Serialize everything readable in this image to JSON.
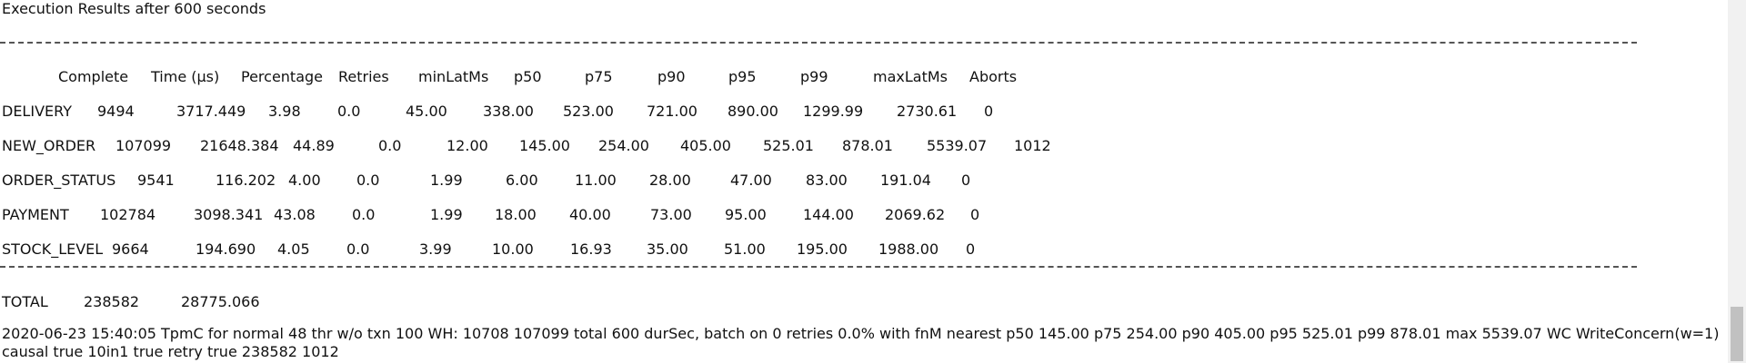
{
  "title": "Execution Results after 600 seconds",
  "divider": "------------------------------------------------------------------------------------------------------------------------------------------------------------------------------------------------------------------------------------------------------------------------------------------------------------",
  "headers": [
    "Complete",
    "Time (µs)",
    "Percentage",
    "Retries",
    "minLatMs",
    "p50",
    "p75",
    "p90",
    "p95",
    "p99",
    "maxLatMs",
    "Aborts"
  ],
  "rows": [
    {
      "cells": [
        "DELIVERY",
        "9494",
        "3717.449",
        "3.98",
        "0.0",
        "45.00",
        "338.00",
        "523.00",
        "721.00",
        "890.00",
        "1299.99",
        "2730.61",
        "0"
      ]
    },
    {
      "cells": [
        "NEW_ORDER",
        "107099",
        "21648.384",
        "44.89",
        "0.0",
        "12.00",
        "145.00",
        "254.00",
        "405.00",
        "525.01",
        "878.01",
        "5539.07",
        "1012"
      ]
    },
    {
      "cells": [
        "ORDER_STATUS",
        "9541",
        "116.202",
        "4.00",
        "0.0",
        "1.99",
        "6.00",
        "11.00",
        "28.00",
        "47.00",
        "83.00",
        "191.04",
        "0"
      ]
    },
    {
      "cells": [
        "PAYMENT",
        "102784",
        "3098.341",
        "43.08",
        "0.0",
        "1.99",
        "18.00",
        "40.00",
        "73.00",
        "95.00",
        "144.00",
        "2069.62",
        "0"
      ]
    },
    {
      "cells": [
        "STOCK_LEVEL",
        "9664",
        "194.690",
        "4.05",
        "0.0",
        "3.99",
        "10.00",
        "16.93",
        "35.00",
        "51.00",
        "195.00",
        "1988.00",
        "0"
      ]
    }
  ],
  "total": {
    "label": "TOTAL",
    "count": "238582",
    "time": "28775.066"
  },
  "summary": "2020-06-23 15:40:05 TpmC for normal 48 thr w/o  txn 100 WH: 10708 107099 total 600 durSec, batch on 0 retries 0.0% with fnM nearest p50 145.00 p75 254.00 p90 405.00 p95 525.01 p99 878.01 max 5539.07 WC WriteConcern(w=1) causal true 10in1 true retry true 238582 1012"
}
